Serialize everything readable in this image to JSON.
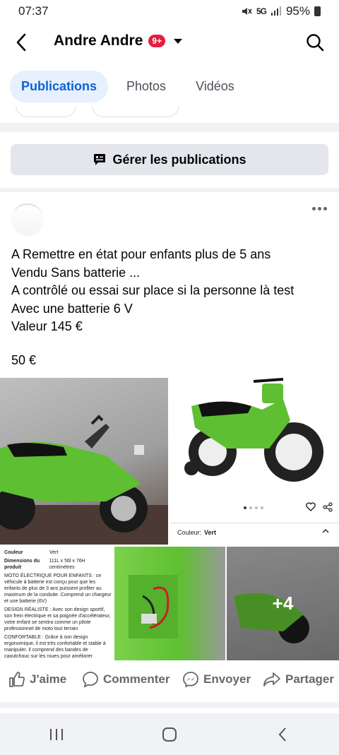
{
  "status_bar": {
    "time": "07:37",
    "network": "5G",
    "battery": "95%"
  },
  "header": {
    "title": "Andre Andre",
    "badge": "9+"
  },
  "tabs": [
    {
      "label": "Publications",
      "active": true
    },
    {
      "label": "Photos",
      "active": false
    },
    {
      "label": "Vidéos",
      "active": false
    }
  ],
  "manage": {
    "label": "Gérer les publications"
  },
  "post": {
    "lines": [
      "A  Remettre en état  pour enfants plus de 5 ans",
      "Vendu Sans batterie ...",
      "A contrôlé ou essai sur place si la personne là test",
      "Avec  une batterie 6 V",
      "Valeur 145 €"
    ],
    "price": "50 €",
    "photos": {
      "more_count": "+4",
      "color_label": "Couleur:",
      "color_value": "Vert",
      "spec_rows": [
        {
          "k": "Couleur",
          "v": "Vert"
        },
        {
          "k": "Dimensions du produit",
          "v": "111L x 56l x 76H centimètres"
        }
      ],
      "spec_bullets": [
        "MOTO ÉLECTRIQUE POUR ENFANTS : ce véhicule à batterie est conçu pour que les enfants de plus de 3 ans puissent profiter au maximum de la conduite. Comprend un chargeur et une batterie (6V)",
        "DESIGN RÉALISTE : Avec son design sportif, son frein électrique et sa poignée d'accélérateur, votre enfant se sentira comme un pilote professionnel de moto tout terrain",
        "CONFORTABLE : Grâce à son design ergonomique, il est très confortable et stable à manipuler. Il comprend des bandes de caoutchouc sur les roues pour améliorer"
      ]
    }
  },
  "actions": {
    "like": "J'aime",
    "comment": "Commenter",
    "send": "Envoyer",
    "share": "Partager"
  },
  "colors": {
    "accent": "#0b62d6",
    "tab_active_bg": "#e7f0fd",
    "badge": "#e41e3f",
    "bike_green": "#5fbf32"
  }
}
